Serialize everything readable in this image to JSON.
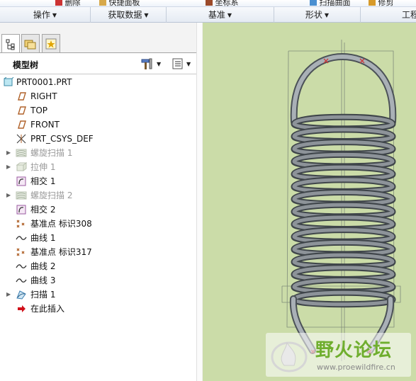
{
  "ribbon_top_fragments": [
    "删除",
    "快捷面板",
    "坐标系",
    "扫描曲面",
    "修剪"
  ],
  "groups": [
    {
      "label": "操作",
      "caret": "▼"
    },
    {
      "label": "获取数据",
      "caret": "▼"
    },
    {
      "label": "基准",
      "caret": "▼"
    },
    {
      "label": "形状",
      "caret": "▼"
    },
    {
      "label": "工程",
      "caret": ""
    }
  ],
  "panel": {
    "tabs": [
      {
        "name": "model-tree-tab",
        "icon": "model-tree-icon"
      },
      {
        "name": "folder-browser-tab",
        "icon": "folder-icon"
      },
      {
        "name": "favorites-tab",
        "icon": "star-icon"
      }
    ],
    "title": "模型树",
    "settings_icon": "tools-icon",
    "show_icon": "list-icon"
  },
  "tree": [
    {
      "label": "PRT0001.PRT",
      "icon": "part-icon",
      "expand": "",
      "root": true,
      "dim": false
    },
    {
      "label": "RIGHT",
      "icon": "datum-plane-icon",
      "expand": "",
      "dim": false
    },
    {
      "label": "TOP",
      "icon": "datum-plane-icon",
      "expand": "",
      "dim": false
    },
    {
      "label": "FRONT",
      "icon": "datum-plane-icon",
      "expand": "",
      "dim": false
    },
    {
      "label": "PRT_CSYS_DEF",
      "icon": "csys-icon",
      "expand": "",
      "dim": false
    },
    {
      "label": "螺旋扫描 1",
      "icon": "helical-sweep-icon",
      "expand": "▶",
      "dim": true
    },
    {
      "label": "拉伸 1",
      "icon": "extrude-icon",
      "expand": "▶",
      "dim": true
    },
    {
      "label": "相交 1",
      "icon": "intersect-icon",
      "expand": "",
      "dim": false
    },
    {
      "label": "螺旋扫描 2",
      "icon": "helical-sweep-icon",
      "expand": "▶",
      "dim": true
    },
    {
      "label": "相交 2",
      "icon": "intersect-icon",
      "expand": "",
      "dim": false
    },
    {
      "label": "基准点 标识308",
      "icon": "datum-point-icon",
      "expand": "",
      "dim": false
    },
    {
      "label": "曲线 1",
      "icon": "curve-icon",
      "expand": "",
      "dim": false
    },
    {
      "label": "基准点 标识317",
      "icon": "datum-point-icon",
      "expand": "",
      "dim": false
    },
    {
      "label": "曲线 2",
      "icon": "curve-icon",
      "expand": "",
      "dim": false
    },
    {
      "label": "曲线 3",
      "icon": "curve-icon",
      "expand": "",
      "dim": false
    },
    {
      "label": "扫描 1",
      "icon": "sweep-icon",
      "expand": "▶",
      "dim": false
    },
    {
      "label": "在此插入",
      "icon": "insert-here-icon",
      "expand": "",
      "dim": false
    }
  ],
  "viewport": {
    "background": "#cbdca8",
    "model": "helical-spring-icon",
    "coil_count": 15
  },
  "watermark": {
    "title": "野火论坛",
    "url": "www.proewildfire.cn",
    "logo": "wildfire-logo-icon"
  },
  "colors": {
    "viewport_bg": "#cbdca8",
    "spring": "#8d9399",
    "watermark_green": "#6fae2e"
  }
}
